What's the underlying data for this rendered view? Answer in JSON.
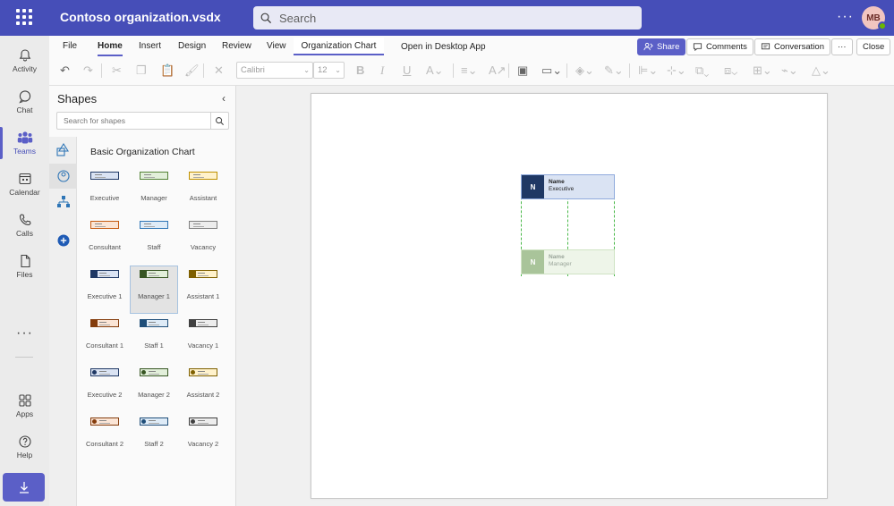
{
  "app": {
    "title": "Contoso organization.vsdx",
    "user_initials": "MB"
  },
  "search": {
    "placeholder": "Search"
  },
  "colors": {
    "teams_purple": "#464eb8",
    "accent": "#5b5fc7"
  },
  "rail": [
    {
      "label": "Activity",
      "icon": "bell-icon"
    },
    {
      "label": "Chat",
      "icon": "chat-icon"
    },
    {
      "label": "Teams",
      "icon": "teams-icon",
      "active": true
    },
    {
      "label": "Calendar",
      "icon": "calendar-icon"
    },
    {
      "label": "Calls",
      "icon": "phone-icon"
    },
    {
      "label": "Files",
      "icon": "file-icon"
    },
    {
      "label": "Apps",
      "icon": "apps-icon"
    },
    {
      "label": "Help",
      "icon": "help-icon"
    }
  ],
  "ribbon": {
    "tabs": [
      "File",
      "Home",
      "Insert",
      "Design",
      "Review",
      "View"
    ],
    "active_tab": "Home",
    "org_chart_tab": "Organization Chart",
    "open_desktop": "Open in Desktop App",
    "share": "Share",
    "comments": "Comments",
    "conversation": "Conversation",
    "more": "···",
    "close": "Close",
    "font_name": "Calibri",
    "font_size": "12"
  },
  "shapes_panel": {
    "title": "Shapes",
    "search_placeholder": "Search for shapes",
    "category": "Basic Organization Chart",
    "items": [
      {
        "label": "Executive",
        "style": "plain",
        "color": "#1f3864",
        "fill": "#dae3f3"
      },
      {
        "label": "Manager",
        "style": "plain",
        "color": "#548235",
        "fill": "#e2efda"
      },
      {
        "label": "Assistant",
        "style": "plain",
        "color": "#bf9000",
        "fill": "#fff2cc"
      },
      {
        "label": "Consultant",
        "style": "plain",
        "color": "#c55a11",
        "fill": "#fbe5d6"
      },
      {
        "label": "Staff",
        "style": "plain",
        "color": "#2e75b6",
        "fill": "#deebf7"
      },
      {
        "label": "Vacancy",
        "style": "plain",
        "color": "#7f7f7f",
        "fill": "#ededed"
      },
      {
        "label": "Executive 1",
        "style": "block",
        "color": "#1f3864",
        "fill": "#dae3f3"
      },
      {
        "label": "Manager 1",
        "style": "block",
        "color": "#375623",
        "fill": "#e2efda",
        "selected": true
      },
      {
        "label": "Assistant 1",
        "style": "block",
        "color": "#7f6000",
        "fill": "#fff2cc"
      },
      {
        "label": "Consultant 1",
        "style": "block",
        "color": "#843c0c",
        "fill": "#fbe5d6"
      },
      {
        "label": "Staff 1",
        "style": "block",
        "color": "#1f4e79",
        "fill": "#deebf7"
      },
      {
        "label": "Vacancy 1",
        "style": "block",
        "color": "#404040",
        "fill": "#ededed"
      },
      {
        "label": "Executive 2",
        "style": "circle",
        "color": "#1f3864",
        "fill": "#dae3f3"
      },
      {
        "label": "Manager 2",
        "style": "circle",
        "color": "#375623",
        "fill": "#e2efda"
      },
      {
        "label": "Assistant 2",
        "style": "circle",
        "color": "#7f6000",
        "fill": "#fff2cc"
      },
      {
        "label": "Consultant 2",
        "style": "circle",
        "color": "#843c0c",
        "fill": "#fbe5d6"
      },
      {
        "label": "Staff 2",
        "style": "circle",
        "color": "#1f4e79",
        "fill": "#deebf7"
      },
      {
        "label": "Vacancy 2",
        "style": "circle",
        "color": "#404040",
        "fill": "#ededed"
      }
    ]
  },
  "canvas": {
    "nodes": [
      {
        "initial": "N",
        "name": "Name",
        "title": "Executive",
        "icon_color": "#1f3864",
        "fill": "#dae3f3",
        "border": "#8faadc",
        "text_color": "#242424"
      },
      {
        "initial": "N",
        "name": "Name",
        "title": "Manager",
        "icon_color": "#a9c49a",
        "fill": "#eef5e9",
        "border": "#cfe3c4",
        "text_color": "#9aa59a"
      }
    ]
  }
}
